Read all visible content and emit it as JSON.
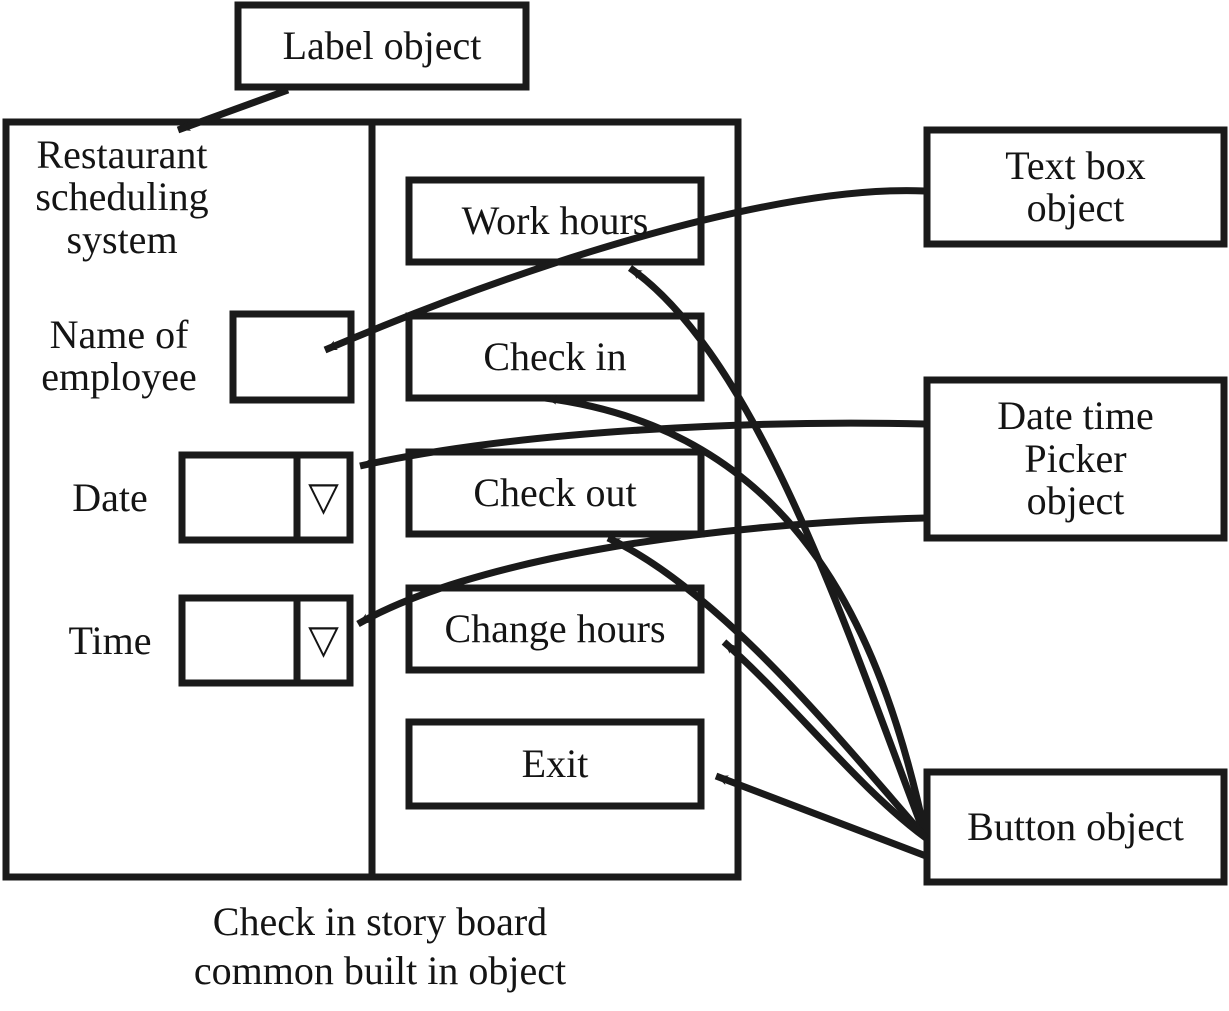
{
  "diagram": {
    "caption": "Check in story board\ncommon built in object",
    "stroke_color": "#1a1a1a",
    "background_color": "#ffffff"
  },
  "annotations": [
    {
      "id": "label-object",
      "text": "Label object"
    },
    {
      "id": "text-box-object",
      "text": "Text box\nobject"
    },
    {
      "id": "date-time-picker",
      "text": "Date time\nPicker\nobject"
    },
    {
      "id": "button-object",
      "text": "Button object"
    }
  ],
  "form": {
    "title": "Restaurant\nscheduling\nsystem",
    "fields": [
      {
        "id": "employee-name",
        "label": "Name of\nemployee",
        "value": "",
        "control": "textbox"
      },
      {
        "id": "date",
        "label": "Date",
        "value": "",
        "control": "datetime-picker",
        "dropdown_glyph": "▽"
      },
      {
        "id": "time",
        "label": "Time",
        "value": "",
        "control": "datetime-picker",
        "dropdown_glyph": "▽"
      }
    ],
    "buttons": [
      {
        "id": "work-hours",
        "label": "Work hours"
      },
      {
        "id": "check-in",
        "label": "Check in"
      },
      {
        "id": "check-out",
        "label": "Check out"
      },
      {
        "id": "change-hours",
        "label": "Change hours"
      },
      {
        "id": "exit",
        "label": "Exit"
      }
    ]
  }
}
